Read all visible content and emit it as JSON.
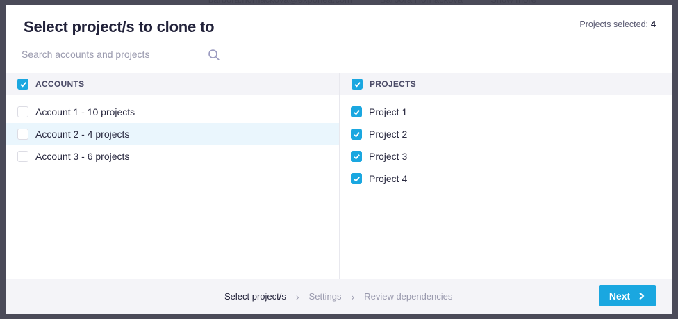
{
  "modal": {
    "title": "Select project/s to clone to",
    "selected_label": "Projects selected:",
    "selected_count": "4"
  },
  "search": {
    "placeholder": "Search accounts and projects",
    "value": ""
  },
  "accounts": {
    "header": "ACCOUNTS",
    "header_checked": true,
    "items": [
      {
        "label": "Account 1 - 10 projects",
        "checked": false
      },
      {
        "label": "Account 2 - 4 projects",
        "checked": false
      },
      {
        "label": "Account 3 - 6 projects",
        "checked": false
      }
    ]
  },
  "projects": {
    "header": "PROJECTS",
    "header_checked": true,
    "items": [
      {
        "label": "Project 1",
        "checked": true
      },
      {
        "label": "Project 2",
        "checked": true
      },
      {
        "label": "Project 3",
        "checked": true
      },
      {
        "label": "Project 4",
        "checked": true
      }
    ]
  },
  "footer": {
    "steps": [
      "Select project/s",
      "Settings",
      "Review dependencies"
    ],
    "next_label": "Next"
  },
  "colors": {
    "accent": "#1aa7e0",
    "hover_row": "#eaf6fd"
  }
}
